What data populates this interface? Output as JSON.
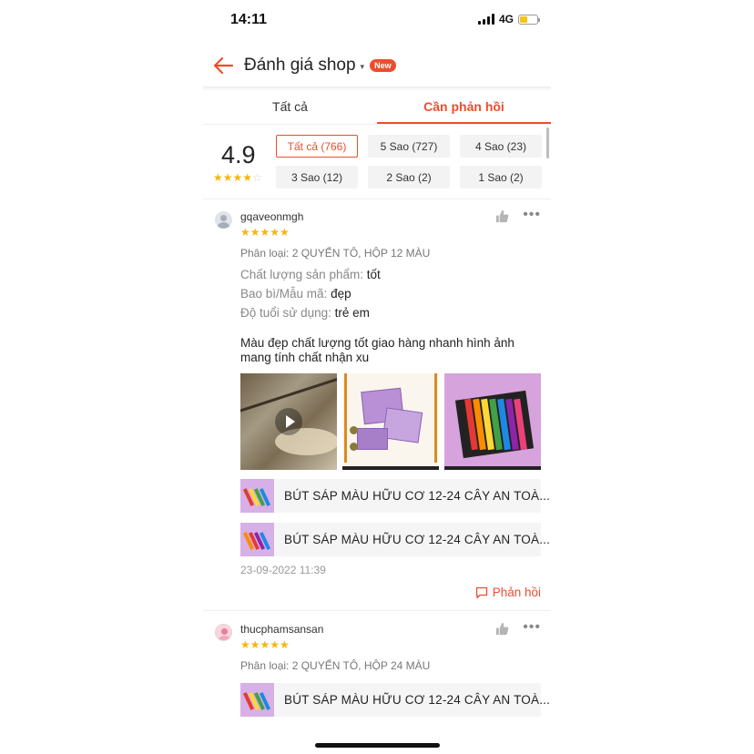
{
  "status_bar": {
    "time": "14:11",
    "network": "4G",
    "battery_level": 0.45
  },
  "header": {
    "title": "Đánh giá shop",
    "caret": "▾",
    "badge": "New"
  },
  "tabs": [
    {
      "label": "Tất cả",
      "active": false
    },
    {
      "label": "Cần phản hồi",
      "active": true
    }
  ],
  "summary": {
    "score": "4.9",
    "stars": 4,
    "filters": [
      "Tất cả (766)",
      "5 Sao (727)",
      "4 Sao (23)",
      "3 Sao (12)",
      "2 Sao (2)",
      "1 Sao (2)"
    ],
    "active_filter": 0
  },
  "reviews": [
    {
      "username": "gqaveonmgh",
      "stars": "★★★★★",
      "variant": "Phân loại: 2 QUYỂN TÔ, HỘP 12 MÀU",
      "attributes": [
        {
          "label": "Chất lượng sản phẩm:",
          "value": "tốt"
        },
        {
          "label": "Bao bì/Mẫu mã:",
          "value": "đẹp"
        },
        {
          "label": "Độ tuổi sử dụng:",
          "value": "trẻ em"
        }
      ],
      "comment": "Màu đẹp chất lượng tốt giao hàng nhanh hình ảnh mang tính chất nhận xu",
      "products": [
        "BÚT SÁP MÀU HỮU CƠ 12-24 CÂY AN TOÀ...",
        "BÚT SÁP MÀU HỮU CƠ 12-24 CÂY AN TOÀ..."
      ],
      "date": "23-09-2022 11:39",
      "reply_label": "Phản hồi"
    },
    {
      "username": "thucphamsansan",
      "stars": "★★★★★",
      "variant": "Phân loại: 2 QUYỂN TÔ, HỘP 24 MÀU",
      "products": [
        "BÚT SÁP MÀU HỮU CƠ 12-24 CÂY AN TOÀ..."
      ]
    }
  ],
  "colors": {
    "accent": "#ee4d2d",
    "star": "#f6b60e"
  }
}
